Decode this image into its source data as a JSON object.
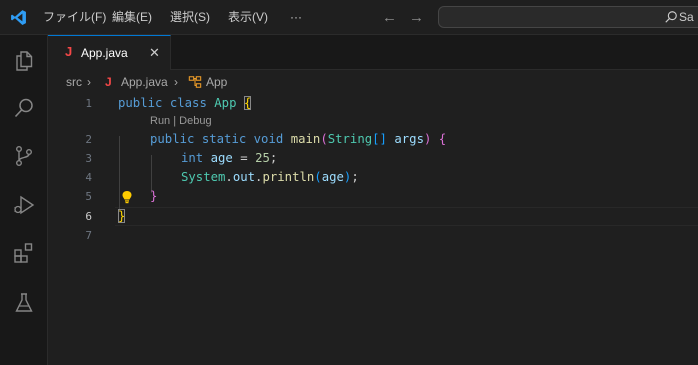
{
  "menu": {
    "file": "ファイル(F)",
    "edit": "編集(E)",
    "selection": "選択(S)",
    "view": "表示(V)",
    "more": "···"
  },
  "nav": {
    "back": "←",
    "forward": "→"
  },
  "search": {
    "text": "Sa"
  },
  "tab": {
    "icon": "J",
    "label": "App.java",
    "close": "✕"
  },
  "breadcrumb": {
    "folder": "src",
    "sep": "›",
    "file_icon": "J",
    "file": "App.java",
    "symbol": "App"
  },
  "codelens": "Run | Debug",
  "code": {
    "line_numbers": [
      "1",
      "2",
      "3",
      "4",
      "5",
      "6",
      "7"
    ],
    "l1": {
      "public": "public",
      "class": "class",
      "name": "App",
      "brace": "{"
    },
    "l2": {
      "public": "public",
      "static": "static",
      "void": "void",
      "fn": "main",
      "paren_open": "(",
      "type": "String",
      "brackets": "[]",
      "arg": "args",
      "paren_close": ")",
      "brace": "{"
    },
    "l3": {
      "type": "int",
      "var": "age",
      "eq": "=",
      "num": "25",
      "semi": ";"
    },
    "l4": {
      "obj": "System",
      "dot1": ".",
      "field": "out",
      "dot2": ".",
      "fn": "println",
      "paren_open": "(",
      "arg": "age",
      "paren_close": ")",
      "semi": ";"
    },
    "l5": {
      "brace": "}"
    },
    "l6": {
      "brace": "}"
    }
  },
  "icons": {
    "logo": "vscode-logo-icon",
    "explorer": "files-icon",
    "search": "search-icon",
    "scm": "source-control-icon",
    "run": "run-debug-icon",
    "extensions": "extensions-icon",
    "testing": "beaker-icon",
    "lightbulb": "lightbulb-icon",
    "class": "symbol-class-icon"
  },
  "colors": {
    "accent": "#0078d4",
    "java_icon": "#f44747",
    "keyword": "#569cd6",
    "type": "#4ec9b0",
    "function": "#dcdcaa",
    "variable": "#9cdcfe",
    "number": "#b5cea8",
    "bracket_level1": "#ffd700",
    "bracket_level2": "#da70d6",
    "bracket_level3": "#179fff"
  }
}
